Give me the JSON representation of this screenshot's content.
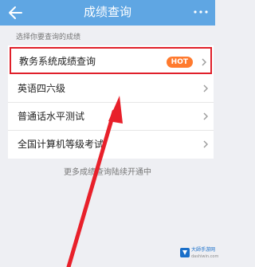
{
  "header": {
    "title": "成绩查询"
  },
  "hint": "选择你要查询的成绩",
  "items": [
    {
      "label": "教务系统成绩查询",
      "badge": "HOT"
    },
    {
      "label": "英语四六级"
    },
    {
      "label": "普通话水平测试"
    },
    {
      "label": "全国计算机等级考试"
    }
  ],
  "footer_note": "更多成绩查询陆续开通中",
  "watermark": {
    "name": "大師手游网",
    "sub": "dashiwin.com"
  },
  "colors": {
    "topbar": "#5fa6e3",
    "highlight_border": "#e0202a",
    "hot_badge": "#ff7a2e",
    "arrow": "#e8202a"
  }
}
